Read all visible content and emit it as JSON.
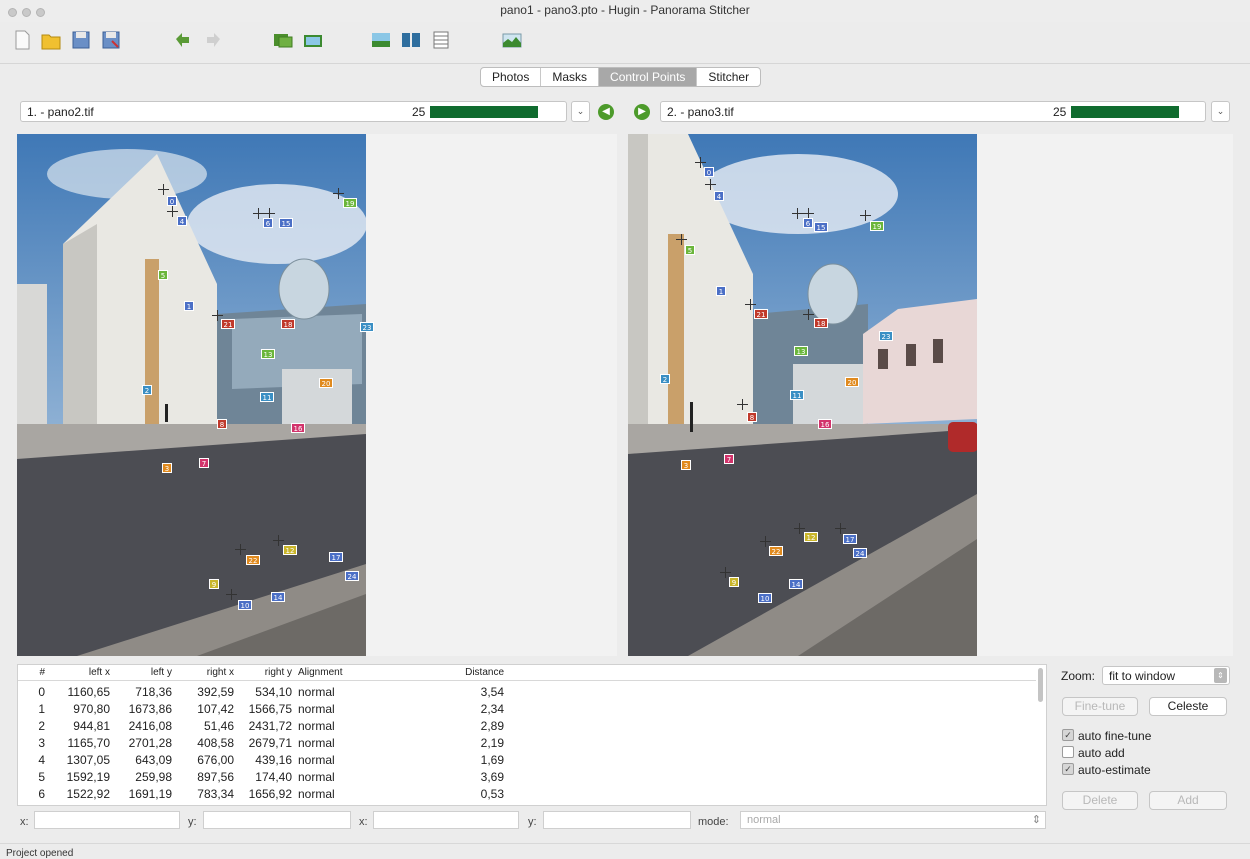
{
  "window": {
    "title": "pano1 - pano3.pto - Hugin - Panorama Stitcher"
  },
  "toolbar": {
    "icons": [
      "new-icon",
      "open-icon",
      "save-icon",
      "save-as-icon",
      "undo-icon",
      "redo-icon",
      "add-images-icon",
      "preview-icon",
      "fast-preview-icon",
      "layout-icon",
      "table-icon",
      "panorama-icon"
    ]
  },
  "tabs": [
    {
      "label": "Photos"
    },
    {
      "label": "Masks"
    },
    {
      "label": "Control Points",
      "active": true
    },
    {
      "label": "Stitcher"
    }
  ],
  "left_image": {
    "label": "1. - pano2.tif",
    "count": "25",
    "fill": 1.0
  },
  "right_image": {
    "label": "2. - pano3.tif",
    "count": "25",
    "fill": 1.0
  },
  "table": {
    "headers": [
      "#",
      "left x",
      "left y",
      "right x",
      "right y",
      "Alignment",
      "Distance"
    ],
    "rows": [
      {
        "id": "0",
        "lx": "1160,65",
        "ly": "718,36",
        "rx": "392,59",
        "ry": "534,10",
        "align": "normal",
        "dist": "3,54"
      },
      {
        "id": "1",
        "lx": "970,80",
        "ly": "1673,86",
        "rx": "107,42",
        "ry": "1566,75",
        "align": "normal",
        "dist": "2,34"
      },
      {
        "id": "2",
        "lx": "944,81",
        "ly": "2416,08",
        "rx": "51,46",
        "ry": "2431,72",
        "align": "normal",
        "dist": "2,89"
      },
      {
        "id": "3",
        "lx": "1165,70",
        "ly": "2701,28",
        "rx": "408,58",
        "ry": "2679,71",
        "align": "normal",
        "dist": "2,19"
      },
      {
        "id": "4",
        "lx": "1307,05",
        "ly": "643,09",
        "rx": "676,00",
        "ry": "439,16",
        "align": "normal",
        "dist": "1,69"
      },
      {
        "id": "5",
        "lx": "1592,19",
        "ly": "259,98",
        "rx": "897,56",
        "ry": "174,40",
        "align": "normal",
        "dist": "3,69"
      },
      {
        "id": "6",
        "lx": "1522,92",
        "ly": "1691,19",
        "rx": "783,34",
        "ry": "1656,92",
        "align": "normal",
        "dist": "0,53"
      }
    ]
  },
  "coords": {
    "x_label": "x:",
    "y_label": "y:",
    "x2_label": "x:",
    "y2_label": "y:",
    "mode_label": "mode:",
    "mode_value": "normal"
  },
  "right_panel": {
    "zoom_label": "Zoom:",
    "zoom_value": "fit to window",
    "fine_tune": "Fine-tune",
    "celeste": "Celeste",
    "auto_fine_tune": "auto fine-tune",
    "auto_add": "auto add",
    "auto_estimate": "auto-estimate",
    "delete": "Delete",
    "add": "Add"
  },
  "status": {
    "text": "Project opened"
  },
  "colors": {
    "accent_green": "#0f6b2e",
    "tab_active": "#a8a8a8"
  }
}
